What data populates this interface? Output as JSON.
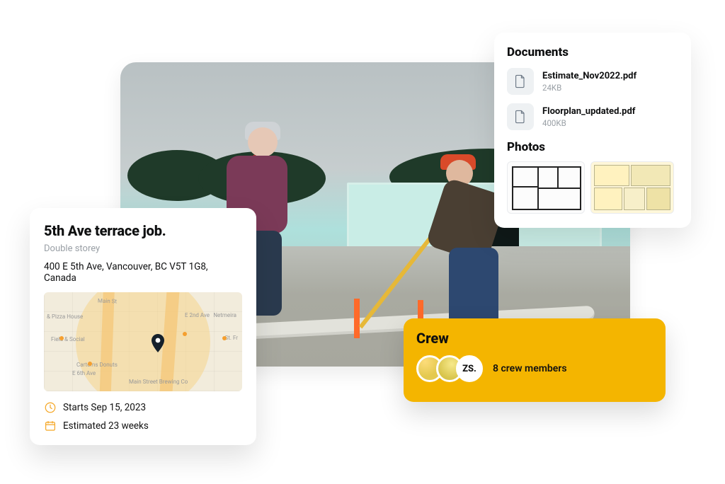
{
  "colors": {
    "accent": "#f4b500",
    "icon_accent": "#f5a623"
  },
  "job": {
    "title": "5th Ave terrace job.",
    "subtype": "Double storey",
    "address": "400 E 5th Ave, Vancouver, BC V5T 1G8, Canada",
    "start_label": "Starts Sep 15, 2023",
    "estimate_label": "Estimated 23 weeks",
    "map_labels": {
      "pizza": "& Pizza House",
      "field": "Field & Social",
      "cartems": "Cartems Donuts",
      "brewing": "Main Street Brewing Co",
      "street_main": "Main St",
      "street_e2": "E 2nd Ave",
      "street_e6": "E 6th Ave",
      "st_fr": "St. Fr",
      "netmeira": "Netmeira"
    }
  },
  "documents": {
    "heading": "Documents",
    "items": [
      {
        "name": "Estimate_Nov2022.pdf",
        "size": "24KB"
      },
      {
        "name": "Floorplan_updated.pdf",
        "size": "400KB"
      }
    ],
    "photos_heading": "Photos"
  },
  "crew": {
    "heading": "Crew",
    "initials": "ZS.",
    "count_label": "8 crew members"
  }
}
